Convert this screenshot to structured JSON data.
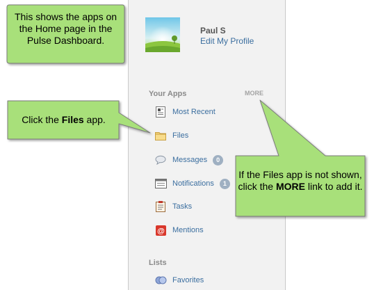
{
  "user": {
    "name": "Paul S",
    "edit_profile": "Edit My Profile"
  },
  "your_apps": {
    "title": "Your Apps",
    "more": "MORE",
    "items": [
      {
        "label": "Most Recent",
        "icon": "most-recent-icon"
      },
      {
        "label": "Files",
        "icon": "folder-icon"
      },
      {
        "label": "Messages",
        "icon": "speech-bubble-icon",
        "badge": "0"
      },
      {
        "label": "Notifications",
        "icon": "notifications-icon",
        "badge": "1"
      },
      {
        "label": "Tasks",
        "icon": "clipboard-icon"
      },
      {
        "label": "Mentions",
        "icon": "at-sign-icon"
      }
    ]
  },
  "lists": {
    "title": "Lists",
    "items": [
      {
        "label": "Favorites",
        "icon": "favorites-icon"
      }
    ]
  },
  "callouts": {
    "home": {
      "text": "This shows the apps on the Home page in the Pulse Dashboard."
    },
    "files": {
      "pre": "Click the ",
      "bold": "Files",
      "post": " app."
    },
    "more": {
      "pre": "If the Files app is not shown, click the ",
      "bold": "MORE",
      "post": " link to add it."
    }
  },
  "colors": {
    "callout_fill": "#a8e07a",
    "callout_border": "#7a7a7a",
    "link": "#3b6e9f",
    "panel_bg": "#f2f2f2"
  }
}
